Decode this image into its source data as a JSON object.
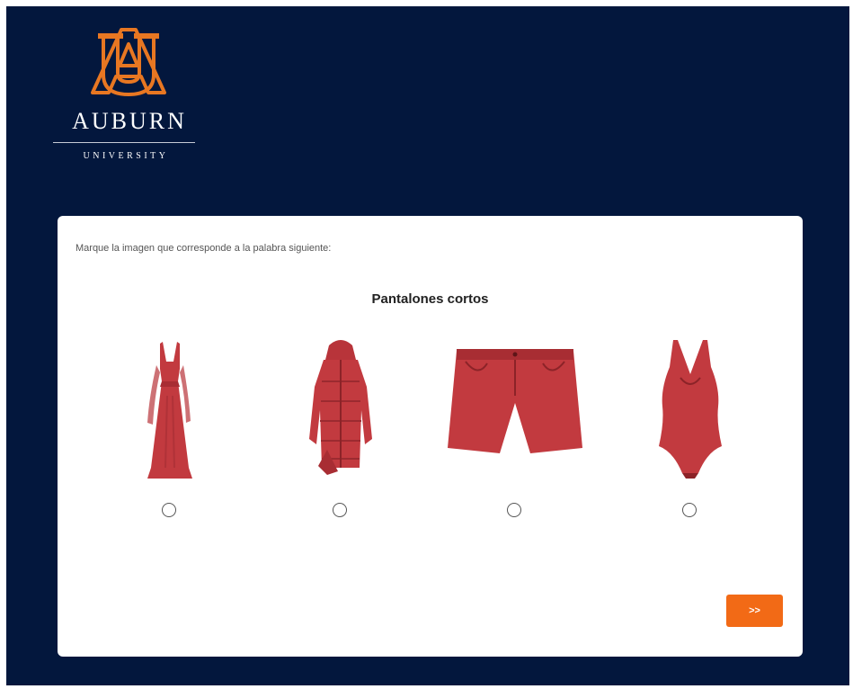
{
  "brand": {
    "name": "AUBURN",
    "subtitle": "UNIVERSITY",
    "monogram": "AU",
    "colors": {
      "navy": "#03173d",
      "orange": "#f26a16",
      "garment_red": "#c23a3f"
    }
  },
  "question": {
    "instruction": "Marque la imagen que corresponde a la palabra siguiente:",
    "word": "Pantalones cortos"
  },
  "options": [
    {
      "icon": "dress-image",
      "selected": false
    },
    {
      "icon": "coat-image",
      "selected": false
    },
    {
      "icon": "shorts-image",
      "selected": false
    },
    {
      "icon": "swimsuit-image",
      "selected": false
    }
  ],
  "next_button": {
    "label": ">>"
  }
}
